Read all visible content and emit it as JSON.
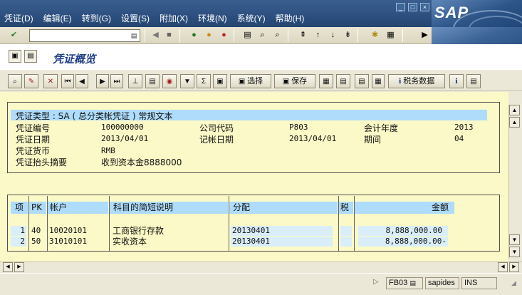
{
  "menu": [
    "凭证(D)",
    "编辑(E)",
    "转到(G)",
    "设置(S)",
    "附加(X)",
    "环境(N)",
    "系统(Y)",
    "帮助(H)"
  ],
  "brand": "SAP",
  "page_title": "凭证概览",
  "app_toolbar": {
    "select_label": "选择",
    "save_label": "保存",
    "tax_label": "税务数据"
  },
  "header": {
    "doc_type_line": "凭证类型 : SA ( 总分类帐凭证 ) 常规文本",
    "doc_no_label": "凭证编号",
    "doc_no": "100000000",
    "company_label": "公司代码",
    "company": "P803",
    "fiscal_year_label": "会计年度",
    "fiscal_year": "2013",
    "doc_date_label": "凭证日期",
    "doc_date": "2013/04/01",
    "post_date_label": "记帐日期",
    "post_date": "2013/04/01",
    "period_label": "期间",
    "period": "04",
    "currency_label": "凭证货币",
    "currency": "RMB",
    "header_text_label": "凭证抬头摘要",
    "header_text": "收到资本金8888000"
  },
  "table": {
    "columns": [
      "项",
      "PK",
      "帐户",
      "科目的简短说明",
      "分配",
      "税",
      "金额"
    ],
    "rows": [
      {
        "item": "1",
        "pk": "40",
        "account": "10020101",
        "desc": "工商银行存款",
        "assign": "20130401",
        "tax": "",
        "amount": "8,888,000.00"
      },
      {
        "item": "2",
        "pk": "50",
        "account": "31010101",
        "desc": "实收资本",
        "assign": "20130401",
        "tax": "",
        "amount": "8,888,000.00-"
      }
    ]
  },
  "status": {
    "tcode": "FB03",
    "user": "sapides",
    "mode": "INS"
  },
  "colors": {
    "menubar": "#2c4f7f",
    "content_bg": "#fbf9c7",
    "highlight": "#aedcfa",
    "title": "#1f3f8a"
  }
}
